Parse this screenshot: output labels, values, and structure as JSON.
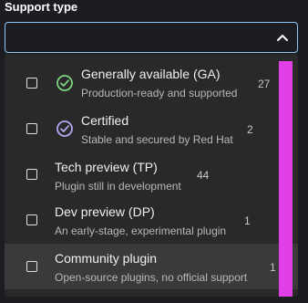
{
  "filter": {
    "label": "Support type",
    "value": "",
    "expanded": true
  },
  "options": [
    {
      "title": "Generally available (GA)",
      "description": "Production-ready and supported",
      "count": "27",
      "icon": "check-circle-icon",
      "icon_color": "#7fd57f",
      "checked": false
    },
    {
      "title": "Certified",
      "description": "Stable and secured by Red Hat",
      "count": "2",
      "icon": "check-circle-icon",
      "icon_color": "#b6a6f0",
      "checked": false
    },
    {
      "title": "Tech preview (TP)",
      "description": "Plugin still in development",
      "count": "44",
      "icon": "",
      "checked": false
    },
    {
      "title": "Dev preview (DP)",
      "description": "An early-stage, experimental plugin",
      "count": "1",
      "icon": "",
      "checked": false
    },
    {
      "title": "Community plugin",
      "description": "Open-source plugins, no official support",
      "count": "1",
      "icon": "",
      "checked": false
    }
  ],
  "colors": {
    "focus_border": "#92c5f9",
    "scrollbar": "#e040e6",
    "menu_bg": "#292929",
    "hover_bg": "#3a3a3a"
  }
}
